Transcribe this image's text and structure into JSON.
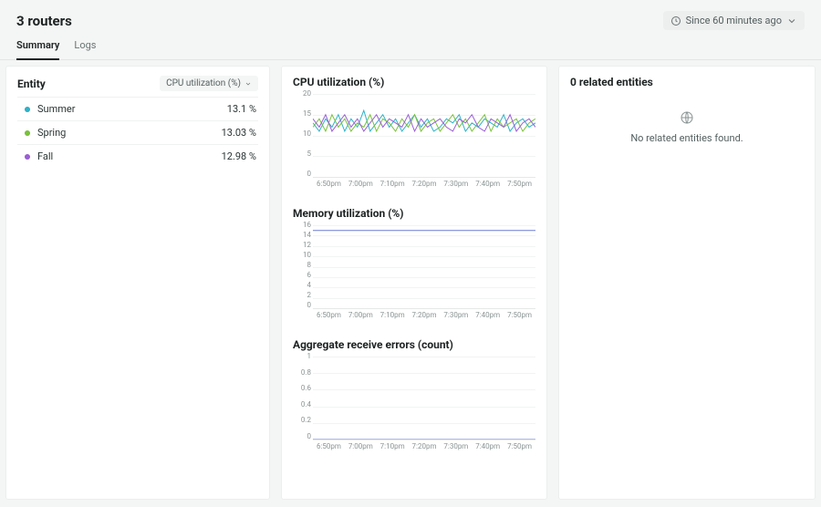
{
  "header": {
    "title": "3 routers",
    "time_label": "Since 60 minutes ago"
  },
  "tabs": [
    {
      "id": "summary",
      "label": "Summary",
      "active": true
    },
    {
      "id": "logs",
      "label": "Logs",
      "active": false
    }
  ],
  "entity_panel": {
    "title": "Entity",
    "metric_select": "CPU utilization (%)",
    "rows": [
      {
        "name": "Summer",
        "value": "13.1 %",
        "color": "#2fb3c9"
      },
      {
        "name": "Spring",
        "value": "13.03 %",
        "color": "#7ac23a"
      },
      {
        "name": "Fall",
        "value": "12.98 %",
        "color": "#9a5fd6"
      }
    ]
  },
  "right_panel": {
    "title": "0 related entities",
    "empty_text": "No related entities found."
  },
  "series_colors": {
    "summer": "#2fb3c9",
    "spring": "#7ac23a",
    "fall": "#9a5fd6",
    "memory": "#6a7bd4"
  },
  "chart_data": [
    {
      "title": "CPU utilization (%)",
      "type": "line",
      "ylabel": "",
      "ylim": [
        0,
        20
      ],
      "yticks": [
        0,
        5,
        10,
        15,
        20
      ],
      "x": [
        "6:50pm",
        "7:00pm",
        "7:10pm",
        "7:20pm",
        "7:30pm",
        "7:40pm",
        "7:50pm"
      ],
      "series": [
        {
          "name": "Summer",
          "color": "summer",
          "values": [
            13,
            11,
            14,
            12,
            15,
            11,
            14,
            12,
            16,
            11,
            13,
            15,
            12,
            14,
            11,
            13,
            15,
            12,
            14,
            11,
            12,
            14,
            13,
            15,
            11,
            13,
            12,
            14,
            13,
            12,
            15,
            11,
            13,
            14,
            12,
            13
          ]
        },
        {
          "name": "Spring",
          "color": "spring",
          "values": [
            12,
            14,
            11,
            15,
            12,
            14,
            11,
            13,
            12,
            15,
            11,
            14,
            13,
            11,
            14,
            12,
            15,
            11,
            13,
            14,
            11,
            13,
            15,
            12,
            14,
            11,
            13,
            15,
            11,
            14,
            12,
            13,
            14,
            11,
            13,
            14
          ]
        },
        {
          "name": "Fall",
          "color": "fall",
          "values": [
            14,
            12,
            15,
            11,
            13,
            15,
            12,
            14,
            11,
            13,
            15,
            12,
            14,
            13,
            12,
            15,
            11,
            14,
            12,
            13,
            14,
            12,
            11,
            14,
            13,
            15,
            12,
            11,
            14,
            13,
            12,
            15,
            11,
            13,
            14,
            12
          ]
        }
      ]
    },
    {
      "title": "Memory utilization (%)",
      "type": "line",
      "ylabel": "",
      "ylim": [
        0,
        16
      ],
      "yticks": [
        0,
        2,
        4,
        6,
        8,
        10,
        12,
        14,
        16
      ],
      "x": [
        "6:50pm",
        "7:00pm",
        "7:10pm",
        "7:20pm",
        "7:30pm",
        "7:40pm",
        "7:50pm"
      ],
      "series": [
        {
          "name": "Memory",
          "color": "memory",
          "values": [
            15,
            15,
            15,
            15,
            15,
            15,
            15,
            15,
            15,
            15,
            15,
            15,
            15,
            15,
            15,
            15,
            15,
            15,
            15,
            15,
            15,
            15,
            15,
            15,
            15,
            15,
            15,
            15,
            15,
            15,
            15,
            15,
            15,
            15,
            15,
            15
          ]
        }
      ]
    },
    {
      "title": "Aggregate receive errors (count)",
      "type": "line",
      "ylabel": "",
      "ylim": [
        0,
        1
      ],
      "yticks": [
        0,
        0.2,
        0.4,
        0.6,
        0.8,
        1
      ],
      "x": [
        "6:50pm",
        "7:00pm",
        "7:10pm",
        "7:20pm",
        "7:30pm",
        "7:40pm",
        "7:50pm"
      ],
      "series": [
        {
          "name": "Errors",
          "color": "memory",
          "values": [
            0,
            0,
            0,
            0,
            0,
            0,
            0,
            0,
            0,
            0,
            0,
            0,
            0,
            0,
            0,
            0,
            0,
            0,
            0,
            0,
            0,
            0,
            0,
            0,
            0,
            0,
            0,
            0,
            0,
            0,
            0,
            0,
            0,
            0,
            0,
            0
          ]
        }
      ]
    }
  ]
}
